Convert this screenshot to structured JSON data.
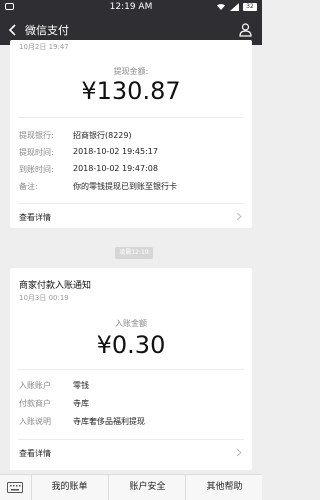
{
  "status_bar": {
    "time": "12:19 AM",
    "battery": "32"
  },
  "header": {
    "title": "微信支付"
  },
  "card1": {
    "date_time": "10月2日  19:47",
    "amount_label": "提现金额:",
    "amount": "¥130.87",
    "rows": [
      {
        "label": "提现银行:",
        "value": "招商银行(8229)"
      },
      {
        "label": "提现时间:",
        "value": "2018-10-02 19:45:17"
      },
      {
        "label": "到账时间:",
        "value": "2018-10-02 19:47:08"
      },
      {
        "label": "备注:",
        "value": "你的零钱提现已到账至银行卡"
      }
    ],
    "details_label": "查看详情"
  },
  "time_separator": "凌晨12:19",
  "card2": {
    "title": "商家付款入账通知",
    "date_time": "10月3日  00:19",
    "amount_label": "入账金额",
    "amount": "¥0.30",
    "rows": [
      {
        "label": "入账账户",
        "value": "零钱"
      },
      {
        "label": "付款商户",
        "value": "寺库"
      },
      {
        "label": "入账说明",
        "value": "寺库奢侈品福利提现"
      }
    ],
    "details_label": "查看详情"
  },
  "bottom_bar": {
    "tabs": [
      "我的账单",
      "账户安全",
      "其他帮助"
    ]
  }
}
